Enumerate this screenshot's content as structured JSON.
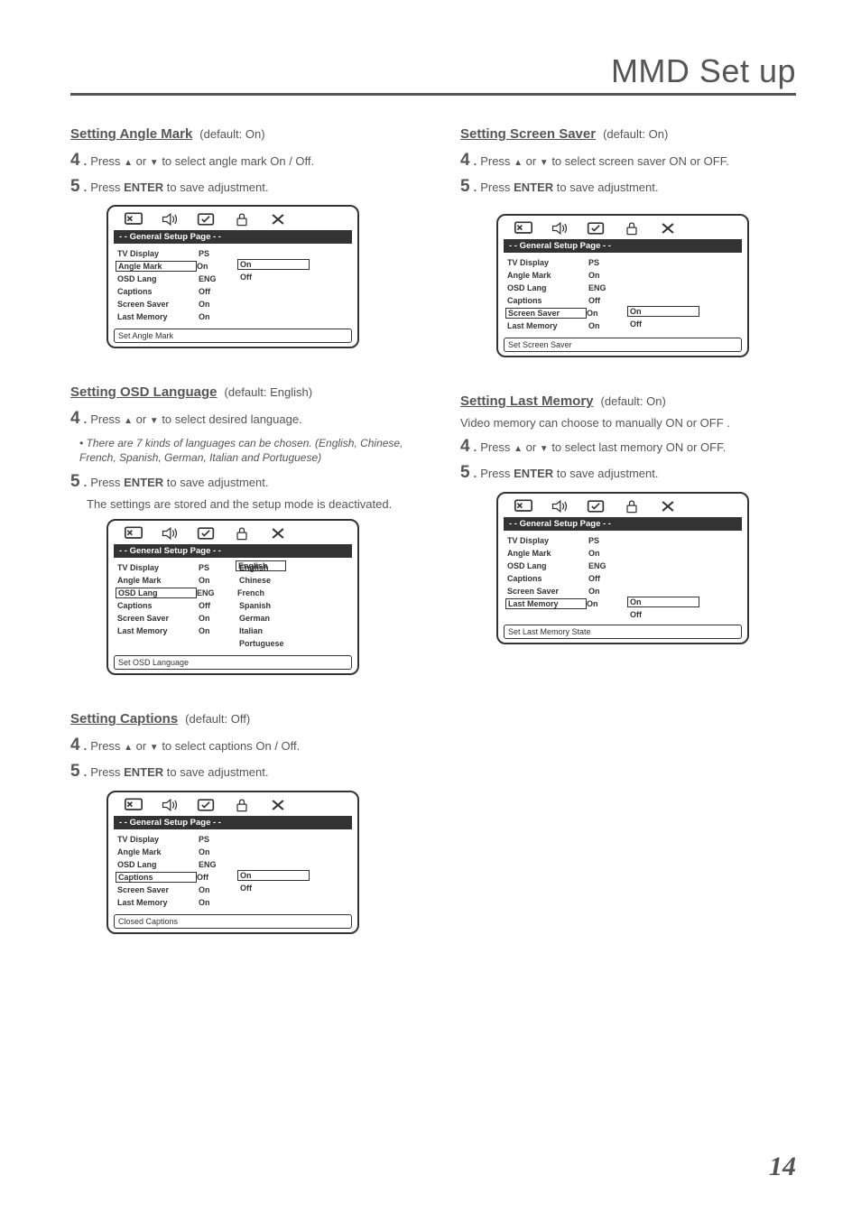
{
  "page_title": "MMD Set up",
  "page_number": "14",
  "enter": "ENTER",
  "step4": "4",
  "step5": "5",
  "dot": ".",
  "press": "Press",
  "or": "or",
  "save_text": "to save adjustment.",
  "menu_header": "- - General Setup Page - -",
  "labels": {
    "tv": "TV Display",
    "angle": "Angle Mark",
    "osd": "OSD Lang",
    "cap": "Captions",
    "ss": "Screen Saver",
    "lm": "Last Memory"
  },
  "vals": {
    "ps": "PS",
    "on": "On",
    "eng": "ENG",
    "off": "Off"
  },
  "angle": {
    "title": "Setting Angle Mark",
    "default": "(default: On)",
    "step4_text": "to select angle mark On / Off.",
    "footer": "Set Angle Mark",
    "opts": {
      "on": "On",
      "off": "Off"
    }
  },
  "osd": {
    "title": "Setting OSD Language",
    "default": "(default: English)",
    "step4_text": "to select desired language.",
    "note_bullet": "•",
    "note": "There are 7 kinds of languages can be chosen. (English, Chinese, French, Spanish, German, Italian and Portuguese)",
    "after": "The settings are stored and the setup mode is deactivated.",
    "footer": "Set OSD Language",
    "langs": [
      "English",
      "Chinese",
      "French",
      "Spanish",
      "German",
      "Italian",
      "Portuguese"
    ]
  },
  "cap": {
    "title": "Setting Captions",
    "default": "(default: Off)",
    "step4_text": "to select captions On / Off.",
    "footer": "Closed Captions",
    "opts": {
      "on": "On",
      "off": "Off"
    }
  },
  "ss": {
    "title": "Setting Screen Saver",
    "default": "(default: On)",
    "step4_text": "to select screen saver ON or OFF.",
    "footer": "Set Screen Saver",
    "opts": {
      "on": "On",
      "off": "Off"
    }
  },
  "lm": {
    "title": "Setting Last Memory",
    "default": "(default: On)",
    "intro": "Video memory can choose to manually ON or OFF .",
    "step4_text": "to select last memory ON or OFF.",
    "footer": "Set Last Memory State",
    "opts": {
      "on": "On",
      "off": "Off"
    }
  }
}
